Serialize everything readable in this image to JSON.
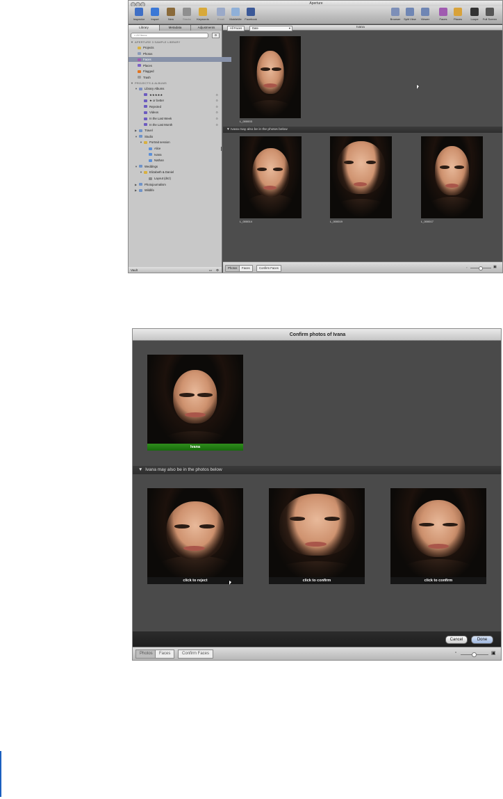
{
  "top_window": {
    "title": "Aperture",
    "toolbar_left": [
      {
        "label": "Inspector",
        "icon": "inspector-icon",
        "color": "#3f6fc5"
      },
      {
        "label": "Import",
        "icon": "import-icon",
        "color": "#3b78d6"
      },
      {
        "label": "New",
        "icon": "new-icon",
        "color": "#8a6a3a"
      },
      {
        "label": "Stacks",
        "icon": "stacks-icon",
        "color": "#8f8f8f"
      },
      {
        "label": "Keywords",
        "icon": "keywords-icon",
        "color": "#d8a93a"
      },
      {
        "label": "Email",
        "icon": "email-icon",
        "color": "#9aa9c8"
      },
      {
        "label": "MobileMe",
        "icon": "mobileme-icon",
        "color": "#8fb0d8"
      },
      {
        "label": "Facebook",
        "icon": "facebook-icon",
        "color": "#3b5998"
      }
    ],
    "toolbar_right": [
      {
        "label": "Browser",
        "icon": "browser-icon",
        "color": "#7d8fb8"
      },
      {
        "label": "Split View",
        "icon": "split-view-icon",
        "color": "#6f86b4"
      },
      {
        "label": "Viewer",
        "icon": "viewer-icon",
        "color": "#6f86b4"
      },
      {
        "label": "Faces",
        "icon": "faces-icon",
        "color": "#a05bb0"
      },
      {
        "label": "Places",
        "icon": "places-icon",
        "color": "#d8a23a"
      },
      {
        "label": "Loupe",
        "icon": "loupe-icon",
        "color": "#333333"
      },
      {
        "label": "Full Screen",
        "icon": "full-screen-icon",
        "color": "#555555"
      }
    ],
    "tabs": [
      "Library",
      "Metadata",
      "Adjustments"
    ],
    "search_placeholder": "All Items",
    "library_header": "APERTURE 3 SAMPLE LIBRARY",
    "library_items": [
      "Projects",
      "Photos",
      "Faces",
      "Places",
      "Flagged",
      "Trash"
    ],
    "projects_header": "PROJECTS & ALBUMS",
    "tree": [
      {
        "label": "Library Albums",
        "level": 1,
        "open": true
      },
      {
        "label": "★★★★★",
        "level": 2
      },
      {
        "label": "★ or better",
        "level": 2
      },
      {
        "label": "Rejected",
        "level": 2
      },
      {
        "label": "Videos",
        "level": 2
      },
      {
        "label": "In the Last Week",
        "level": 2
      },
      {
        "label": "In the Last Month",
        "level": 2
      },
      {
        "label": "Travel",
        "level": 1
      },
      {
        "label": "Studio",
        "level": 1,
        "open": true
      },
      {
        "label": "Portrait session",
        "level": 2,
        "open": true
      },
      {
        "label": "Alice",
        "level": 3
      },
      {
        "label": "Ivana",
        "level": 3
      },
      {
        "label": "Nathan",
        "level": 3
      },
      {
        "label": "Weddings",
        "level": 1,
        "open": true
      },
      {
        "label": "Elizabeth & Daniel",
        "level": 2,
        "open": true
      },
      {
        "label": "Layout (dnz)",
        "level": 3
      },
      {
        "label": "Photojournalism",
        "level": 1
      },
      {
        "label": "Wildlife",
        "level": 1
      }
    ],
    "sidebar_footer": "Vault",
    "browser": {
      "all_faces_button": "All Faces",
      "sort_select": "Date",
      "name": "Ivana",
      "main_caption": "L_000003",
      "section_label": "Ivana may also be in the photos below",
      "captions": [
        "L_000014",
        "L_000019",
        "L_000017"
      ]
    },
    "bottom_tabs": [
      "Photos",
      "Faces"
    ],
    "confirm_button": "Confirm Faces"
  },
  "confirm_window": {
    "title": "Confirm photos of Ivana",
    "main_name": "Ivana",
    "section_label": "Ivana may also be in the photos below",
    "thumb_labels": [
      "click to reject",
      "click to confirm",
      "click to confirm"
    ],
    "cancel": "Cancel",
    "done": "Done",
    "bottom_tabs": [
      "Photos",
      "Faces"
    ],
    "confirm_button": "Confirm Faces"
  },
  "colors": {
    "selection": "#8791a8",
    "green_band": "#2f8d1c",
    "window_bg": "#4a4a4a"
  }
}
